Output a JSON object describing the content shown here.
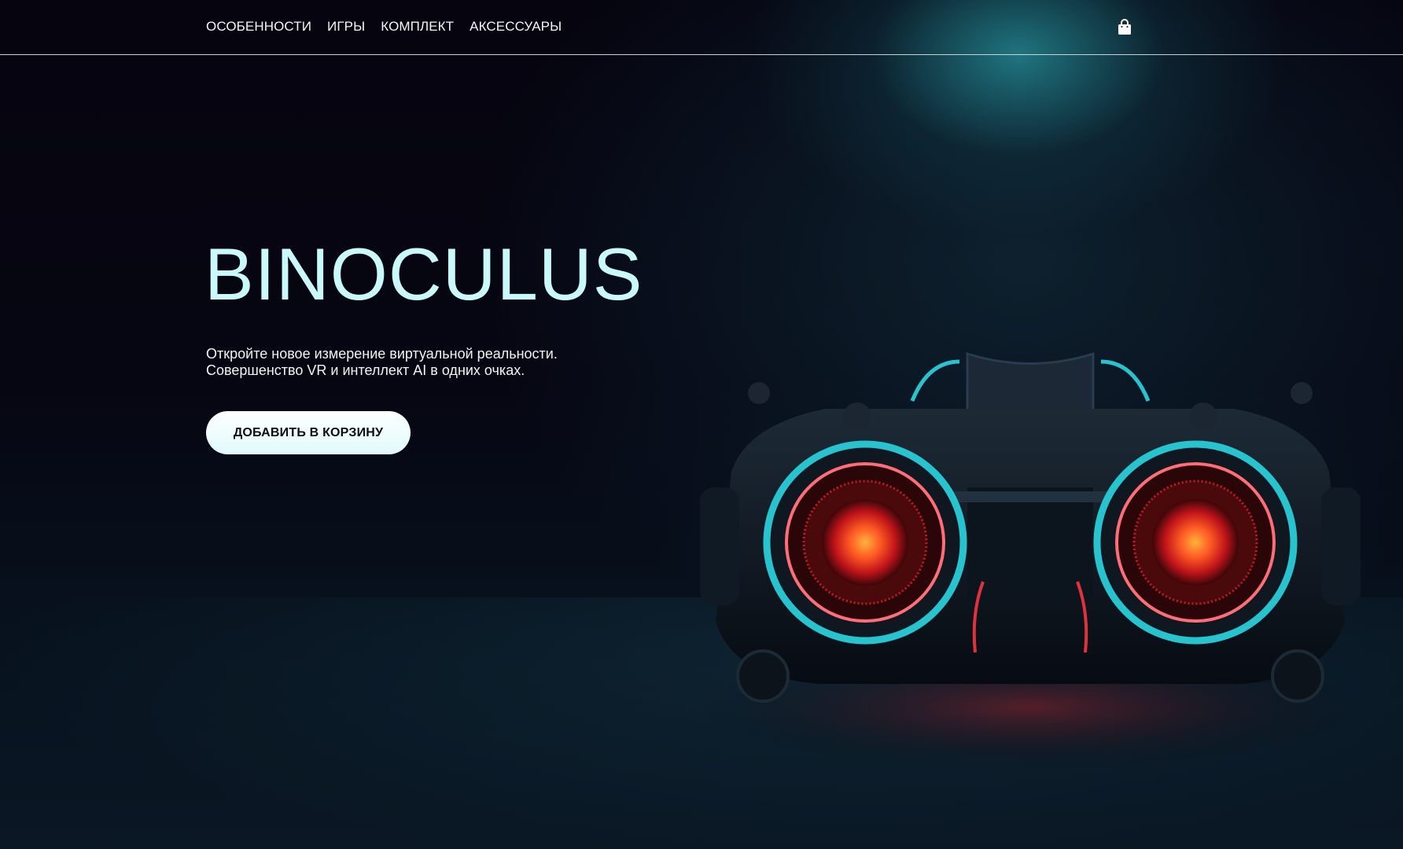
{
  "nav": {
    "links": [
      "ОСОБЕННОСТИ",
      "ИГРЫ",
      "КОМПЛЕКТ",
      "АКСЕССУАРЫ"
    ]
  },
  "header": {
    "cart_icon": "shopping-bag-icon"
  },
  "hero": {
    "title": "BINOCULUS",
    "subtitle_line1": "Откройте новое измерение виртуальной реальности.",
    "subtitle_line2": "Совершенство VR и интеллект AI в одних очках.",
    "cta_label": "ДОБАВИТЬ В КОРЗИНУ"
  },
  "colors": {
    "background": "#04030d",
    "accent_cyan": "#27c4d0",
    "title": "#c9f9fb",
    "lens_red": "#ff3a2a"
  }
}
